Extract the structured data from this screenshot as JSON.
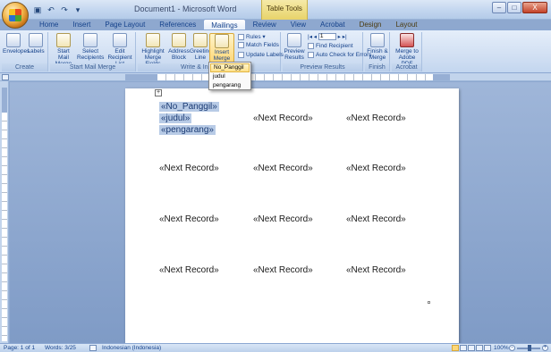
{
  "titlebar": {
    "title": "Document1 - Microsoft Word",
    "contextual_tab": "Table Tools",
    "minimize": "–",
    "maximize": "□",
    "close": "X"
  },
  "tabs": [
    "Home",
    "Insert",
    "Page Layout",
    "References",
    "Mailings",
    "Review",
    "View",
    "Acrobat",
    "Design",
    "Layout"
  ],
  "active_tab": "Mailings",
  "ribbon": {
    "groups": {
      "create": "Create",
      "start_mail_merge": "Start Mail Merge",
      "write_insert": "Write & Insert Fields",
      "preview": "Preview Results",
      "finish": "Finish",
      "acrobat": "Acrobat"
    },
    "buttons": {
      "envelopes": "Envelopes",
      "labels": "Labels",
      "start_mail_merge": "Start Mail Merge",
      "select_recipients": "Select Recipients",
      "edit_recipient_list": "Edit Recipient List",
      "highlight_merge_fields": "Highlight Merge Fields",
      "address_block": "Address Block",
      "greeting_line": "Greeting Line",
      "insert_merge_field": "Insert Merge Field",
      "rules": "Rules",
      "match_fields": "Match Fields",
      "update_labels": "Update Labels",
      "preview_results": "Preview Results",
      "record_number": "1",
      "find_recipient": "Find Recipient",
      "auto_check": "Auto Check for Errors",
      "finish_merge": "Finish & Merge",
      "merge_to_pdf": "Merge to Adobe PDF"
    }
  },
  "merge_field_menu": [
    "No_Panggil",
    "judul",
    "pengarang"
  ],
  "document": {
    "first_record": [
      "«No_Panggil»",
      "«judul»",
      "«pengarang»"
    ],
    "next_record": "«Next Record»"
  },
  "statusbar": {
    "page": "Page: 1 of 1",
    "words": "Words: 3/25",
    "language": "Indonesian (Indonesia)",
    "zoom": "100%"
  }
}
